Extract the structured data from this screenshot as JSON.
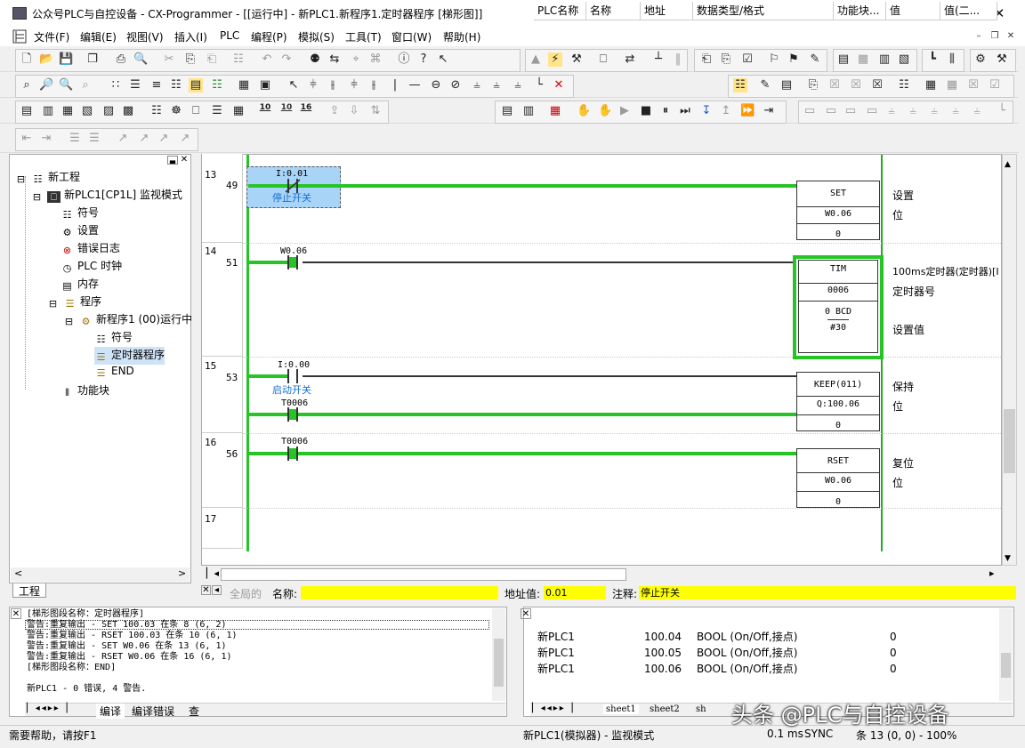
{
  "window": {
    "title": "公众号PLC与自控设备 - CX-Programmer - [[运行中] - 新PLC1.新程序1.定时器程序 [梯形图]]"
  },
  "menu": [
    "文件(F)",
    "编辑(E)",
    "视图(V)",
    "插入(I)",
    "PLC",
    "编程(P)",
    "模拟(S)",
    "工具(T)",
    "窗口(W)",
    "帮助(H)"
  ],
  "toolbar": {
    "num10": "10",
    "num10b": "10",
    "num16": "16"
  },
  "tree": {
    "items": [
      "新工程",
      "新PLC1[CP1L] 监视模式",
      "符号",
      "设置",
      "错误日志",
      "PLC 时钟",
      "内存",
      "程序",
      "新程序1 (00)运行中",
      "符号",
      "定时器程序",
      "END",
      "功能块"
    ],
    "tab": "工程"
  },
  "ladder": {
    "rungs": [
      {
        "num": "13",
        "step": "49",
        "contact": "I:0.01",
        "contact_comment": "停止开关",
        "instr": "SET",
        "op": "W0.06",
        "val": "0",
        "c1": "设置",
        "c2": "位"
      },
      {
        "num": "14",
        "step": "51",
        "contact": "W0.06",
        "instr": "TIM",
        "op": "0006",
        "op2": "0 BCD",
        "val": "#30",
        "c1": "100ms定时器(定时器)[I",
        "c2": "定时器号",
        "c3": "设置值"
      },
      {
        "num": "15",
        "step": "53",
        "contact": "I:0.00",
        "contact_comment": "启动开关",
        "contact2": "T0006",
        "instr": "KEEP(011)",
        "op": "Q:100.06",
        "val": "0",
        "c1": "保持",
        "c2": "位"
      },
      {
        "num": "16",
        "step": "56",
        "contact": "T0006",
        "instr": "RSET",
        "op": "W0.06",
        "val": "0",
        "c1": "复位",
        "c2": "位"
      },
      {
        "num": "17"
      }
    ]
  },
  "infobar": {
    "global": "全局的",
    "name_label": "名称:",
    "name_value": "",
    "addr_label": "地址值:",
    "addr_value": "0.01",
    "comment_label": "注释:",
    "comment_value": "停止开关"
  },
  "output": {
    "lines": [
      "[梯形图段名称：定时器程序]",
      "警告:重复输出 - SET 100.03 在条 8 (6, 2)",
      "警告:重复输出 - RSET 100.03 在条 10 (6, 1)",
      "警告:重复输出 - SET W0.06 在条 13 (6, 1)",
      "警告:重复输出 - RSET W0.06 在条 16 (6, 1)",
      "[梯形图段名称：END]",
      "",
      "新PLC1 - 0 错误, 4 警告."
    ],
    "tabs": [
      "编译",
      "编译错误",
      "查"
    ]
  },
  "watch": {
    "headers": [
      "PLC名称",
      "名称",
      "地址",
      "数据类型/格式",
      "功能块...",
      "值",
      "值(二..."
    ],
    "rows": [
      [
        "新PLC1",
        "",
        "100.04",
        "BOOL (On/Off,接点)",
        "",
        "0",
        ""
      ],
      [
        "新PLC1",
        "",
        "100.05",
        "BOOL (On/Off,接点)",
        "",
        "0",
        ""
      ],
      [
        "新PLC1",
        "",
        "100.06",
        "BOOL (On/Off,接点)",
        "",
        "0",
        ""
      ]
    ],
    "tabs": [
      "sheet1",
      "sheet2",
      "sh"
    ]
  },
  "status": {
    "help": "需要帮助，请按F1",
    "mode": "新PLC1(模拟器) - 监视模式",
    "scan": "0.1 ms",
    "sync": "SYNC",
    "pos": "条 13 (0, 0) - 100%"
  },
  "watermark": "头条 @PLC与自控设备",
  "colors": {
    "energized": "#27c427",
    "selected": "#a8d4f7",
    "field": "#ffff00"
  }
}
